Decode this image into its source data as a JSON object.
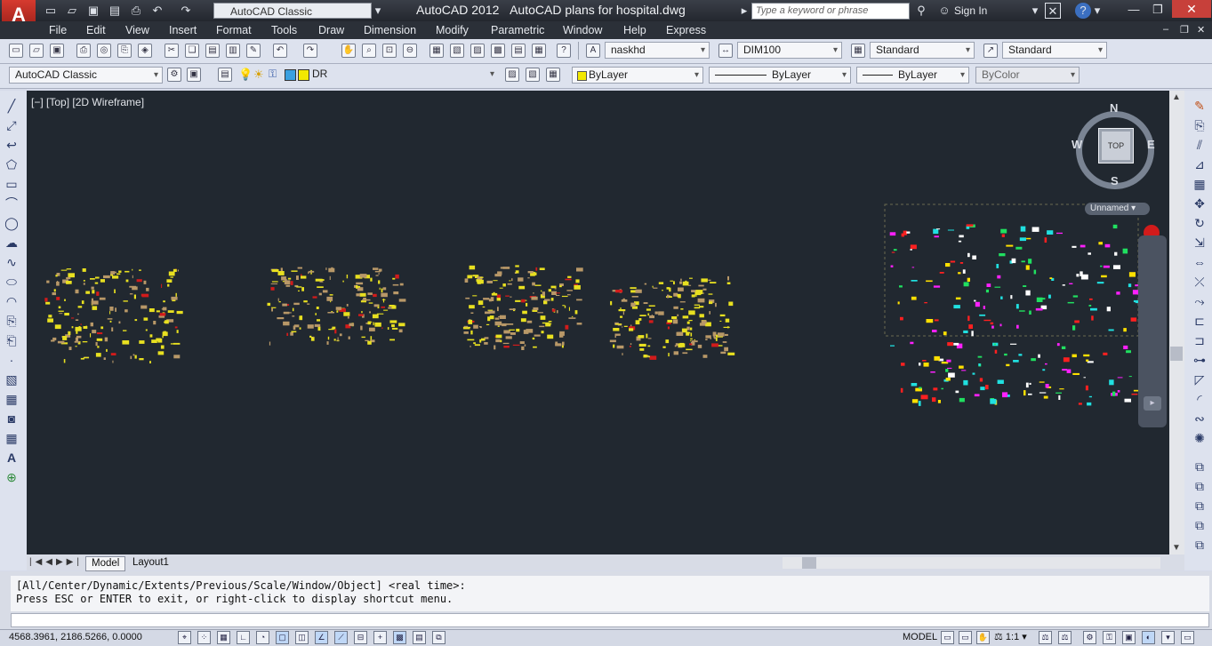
{
  "title_bar": {
    "app_version": "AutoCAD 2012",
    "document_title": "AutoCAD plans for hospital.dwg",
    "workspace": "AutoCAD Classic",
    "search_placeholder": "Type a keyword or phrase",
    "sign_in_label": "Sign In"
  },
  "menu": [
    "File",
    "Edit",
    "View",
    "Insert",
    "Format",
    "Tools",
    "Draw",
    "Dimension",
    "Modify",
    "Parametric",
    "Window",
    "Help",
    "Express"
  ],
  "toolbar_styles": {
    "text_style": "naskhd",
    "dim_style": "DIM100",
    "table_style": "Standard",
    "multileader_style": "Standard"
  },
  "toolbar_layers": {
    "workspace": "AutoCAD Classic",
    "current_layer": "DR",
    "color": "ByLayer",
    "linetype": "ByLayer",
    "lineweight": "ByLayer",
    "plot_style": "ByColor"
  },
  "viewport": {
    "label": "[−] [Top] [2D Wireframe]",
    "viewcube_face": "TOP",
    "compass": {
      "n": "N",
      "s": "S",
      "e": "E",
      "w": "W"
    },
    "ucs": "Unnamed"
  },
  "layout_tabs": [
    "Model",
    "Layout1"
  ],
  "command_line": {
    "line1": "[All/Center/Dynamic/Extents/Previous/Scale/Window/Object] <real time>:",
    "line2": "Press ESC or ENTER to exit, or right-click to display shortcut menu."
  },
  "status": {
    "coords": "4568.3961, 2186.5266, 0.0000",
    "space": "MODEL",
    "annotation_scale": "1:1"
  },
  "colors": {
    "canvas": "#212830",
    "drawing_yellow": "#e8e020",
    "drawing_tan": "#b89868",
    "accent_red": "#d21b1b"
  }
}
